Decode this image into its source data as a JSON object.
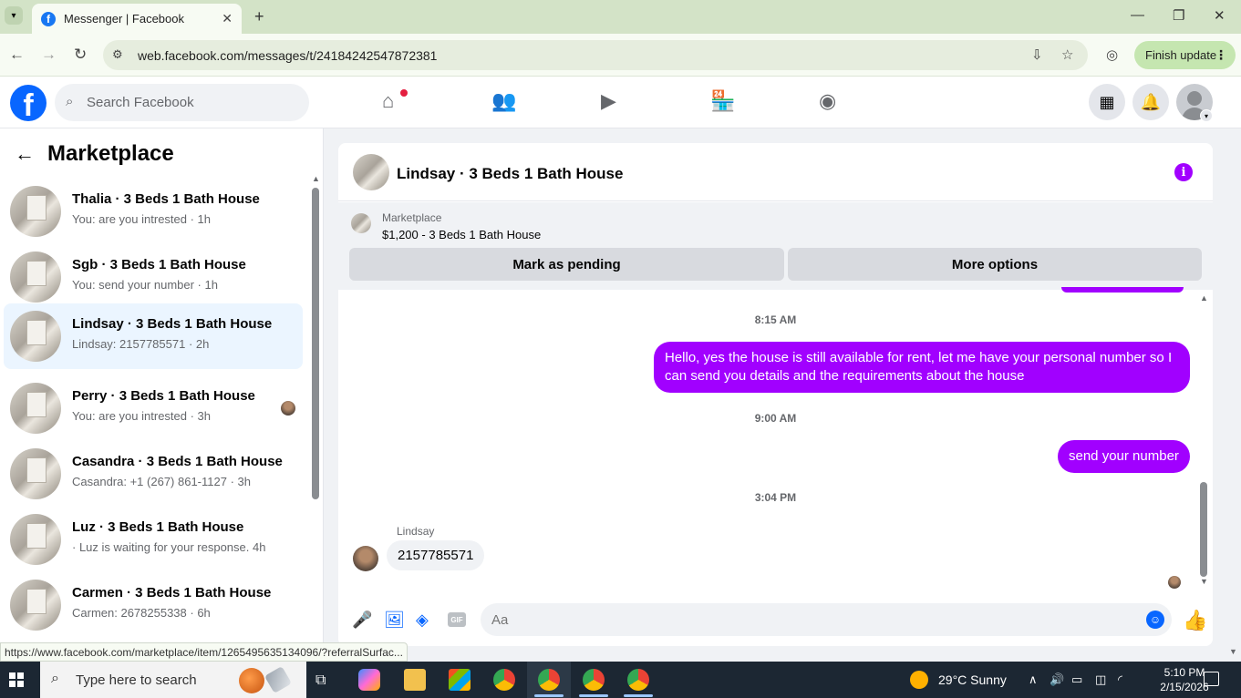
{
  "browser": {
    "tab_title": "Messenger | Facebook",
    "url": "web.facebook.com/messages/t/24184242547872381",
    "finish_update": "Finish update",
    "status_url": "https://www.facebook.com/marketplace/item/1265495635134096/?referralSurfac..."
  },
  "fb": {
    "search_placeholder": "Search Facebook"
  },
  "sidebar": {
    "title": "Marketplace",
    "conversations": [
      {
        "name": "Thalia · 3 Beds 1 Bath House",
        "sub": "You: are you intrested · 1h"
      },
      {
        "name": "Sgb · 3 Beds 1 Bath House",
        "sub": "You: send your number · 1h"
      },
      {
        "name": "Lindsay · 3 Beds 1 Bath House",
        "sub": "Lindsay: 2157785571 · 2h"
      },
      {
        "name": "Perry · 3 Beds 1 Bath House",
        "sub": "You: are you intrested · 3h"
      },
      {
        "name": "Casandra · 3 Beds 1 Bath House",
        "sub": "Casandra: +1 (267) 861-1127 · 3h"
      },
      {
        "name": "Luz · 3 Beds 1 Bath House",
        "sub": "· Luz is waiting for your response. 4h"
      },
      {
        "name": "Carmen · 3 Beds 1 Bath House",
        "sub": "Carmen: 2678255338 · 6h"
      }
    ]
  },
  "chat": {
    "title": "Lindsay · 3 Beds 1 Bath House",
    "marketplace_label": "Marketplace",
    "listing": "$1,200 - 3 Beds 1 Bath House",
    "mark_pending": "Mark as pending",
    "more_options": "More options",
    "messages": [
      {
        "time": "8:15 AM",
        "text": "Hello, yes the house is still available for rent, let me have your personal number so I can send you details and the requirements about the house"
      },
      {
        "time": "9:00 AM",
        "text": "send your number"
      },
      {
        "time": "3:04 PM",
        "sender": "Lindsay",
        "text": "2157785571"
      }
    ],
    "input_placeholder": "Aa",
    "gif_label": "GIF"
  },
  "taskbar": {
    "search_placeholder": "Type here to search",
    "weather": "29°C  Sunny",
    "time": "5:10 PM",
    "date": "2/15/2026"
  },
  "colors": {
    "accent_purple": "#a100ff",
    "fb_blue": "#0866ff"
  }
}
